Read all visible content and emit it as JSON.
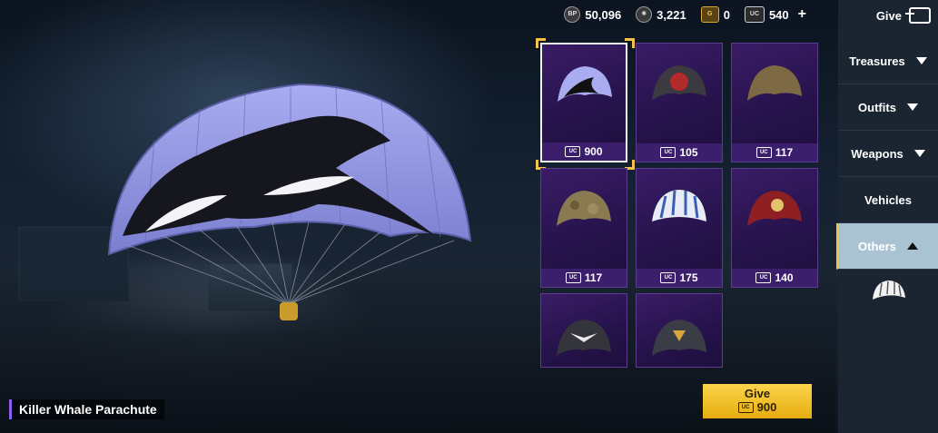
{
  "currency": {
    "bp": {
      "icon": "bp-icon",
      "label": "BP",
      "value": "50,096"
    },
    "silver": {
      "icon": "silver-fragment-icon",
      "value": "3,221"
    },
    "gold": {
      "icon": "gold-coin-icon",
      "label": "G",
      "value": "0"
    },
    "uc": {
      "icon": "uc-icon",
      "label": "UC",
      "value": "540"
    }
  },
  "header": {
    "give_label": "Give"
  },
  "sidebar": {
    "items": [
      {
        "label": "Treasures"
      },
      {
        "label": "Outfits"
      },
      {
        "label": "Weapons"
      },
      {
        "label": "Vehicles"
      },
      {
        "label": "Others"
      }
    ]
  },
  "items": [
    {
      "name": "killer-whale-parachute",
      "price": "900",
      "selected": true
    },
    {
      "name": "red-emblem-parachute",
      "price": "105"
    },
    {
      "name": "sand-camo-parachute",
      "price": "117"
    },
    {
      "name": "desert-camo-parachute",
      "price": "117"
    },
    {
      "name": "blue-white-striped-parachute",
      "price": "175"
    },
    {
      "name": "red-crest-parachute",
      "price": "140"
    },
    {
      "name": "winged-emblem-parachute",
      "price": "—"
    },
    {
      "name": "gold-emblem-parachute",
      "price": "—"
    }
  ],
  "preview": {
    "item_title": "Killer Whale Parachute"
  },
  "give_button": {
    "label": "Give",
    "price": "900"
  },
  "colors": {
    "accent": "#f4c24b",
    "card_bg": "#2b1553",
    "sidebar_active": "#aac3d2"
  }
}
